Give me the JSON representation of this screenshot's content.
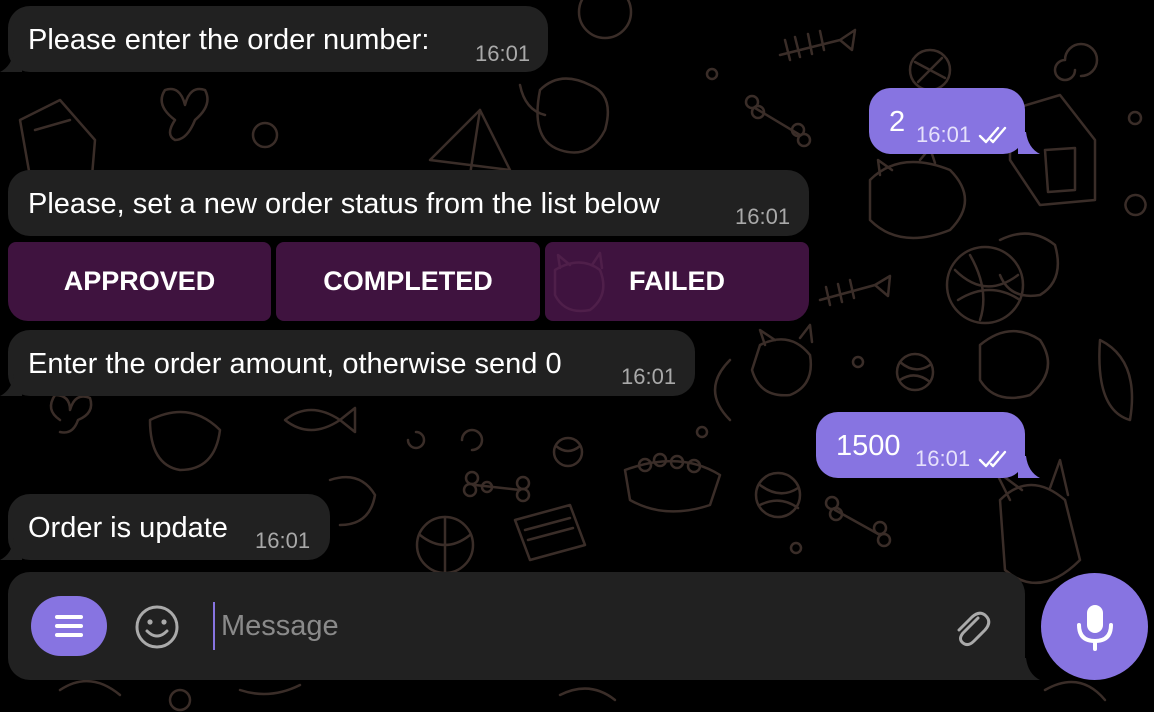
{
  "colors": {
    "background": "#000000",
    "incoming_bubble": "#212121",
    "outgoing_bubble": "#8774e1",
    "accent": "#8774e1",
    "keyboard_button": "#581a58",
    "doodle_stroke": "#3a2d28"
  },
  "messages": [
    {
      "direction": "in",
      "text": "Please enter the order number:",
      "time": "16:01"
    },
    {
      "direction": "out",
      "text": "2",
      "time": "16:01",
      "status": "read"
    },
    {
      "direction": "in",
      "text": "Please, set a new order status from the list below",
      "time": "16:01"
    },
    {
      "direction": "in",
      "text": "Enter the order amount, otherwise send 0",
      "time": "16:01"
    },
    {
      "direction": "out",
      "text": "1500",
      "time": "16:01",
      "status": "read"
    },
    {
      "direction": "in",
      "text": "Order is update",
      "time": "16:01"
    }
  ],
  "inline_keyboard": [
    {
      "label": "APPROVED"
    },
    {
      "label": "COMPLETED"
    },
    {
      "label": "FAILED"
    }
  ],
  "composer": {
    "placeholder": "Message",
    "value": "",
    "menu_icon": "menu-icon",
    "emoji_icon": "smiley-icon",
    "attach_icon": "paperclip-icon",
    "send_icon": "microphone-icon"
  }
}
